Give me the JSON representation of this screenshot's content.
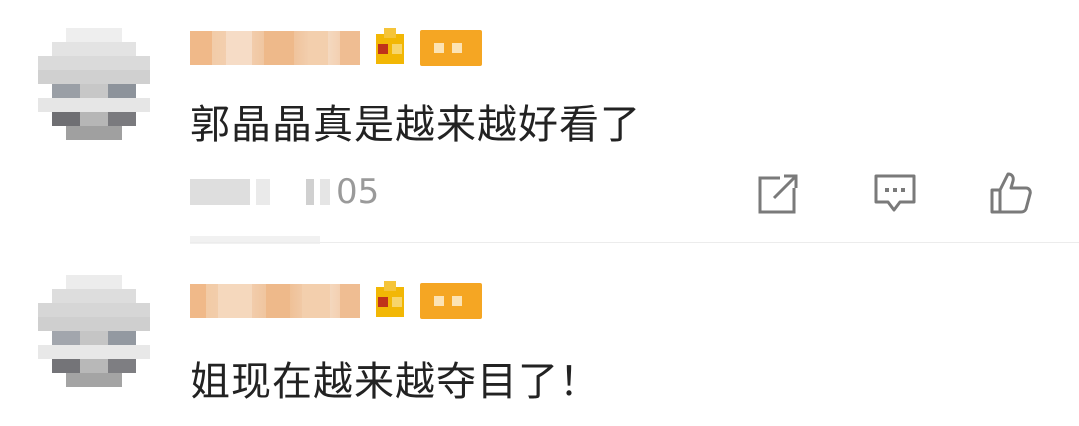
{
  "comments": [
    {
      "text": "郭晶晶真是越来越好看了",
      "meta_time": "05"
    },
    {
      "text": "姐现在越来越夺目了！"
    }
  ],
  "icons": {
    "share": "share-icon",
    "reply": "comment-icon",
    "like": "thumbs-up-icon"
  },
  "colors": {
    "level_badge": "#f5a623",
    "vip_badge": "#f2b705",
    "text": "#222222",
    "meta": "#9a9a9a",
    "icon": "#7a7a7a"
  }
}
